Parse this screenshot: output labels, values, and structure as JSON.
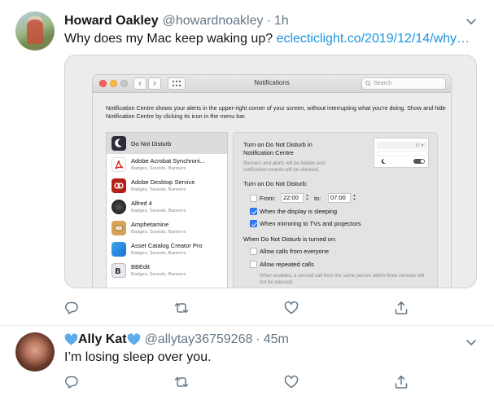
{
  "tweets": [
    {
      "name": "Howard Oakley",
      "handle": "@howardnoakley",
      "time": "1h",
      "text": "Why does my Mac keep waking up? ",
      "link": "eclecticlight.co/2019/12/14/why…",
      "media": {
        "window_title": "Notifications",
        "search_placeholder": "Search",
        "description": "Notification Centre shows your alerts in the upper-right corner of your screen, without interrupting what you're doing. Show and hide Notification Centre by clicking its icon in the menu bar.",
        "apps": [
          {
            "name": "Do Not Disturb",
            "sub": "",
            "selected": true
          },
          {
            "name": "Adobe Acrobat Synchroni...",
            "sub": "Badges, Sounds, Banners"
          },
          {
            "name": "Adobe Desktop Service",
            "sub": "Badges, Sounds, Banners"
          },
          {
            "name": "Alfred 4",
            "sub": "Badges, Sounds, Banners"
          },
          {
            "name": "Amphetamine",
            "sub": "Badges, Sounds, Banners"
          },
          {
            "name": "Asset Catalog Creator Pro",
            "sub": "Badges, Sounds, Banners"
          },
          {
            "name": "BBEdit",
            "sub": "Badges, Sounds, Banners"
          }
        ],
        "pane": {
          "turn_on_title": "Turn on Do Not Disturb in Notification Centre",
          "turn_on_desc": "Banners and alerts will be hidden and notification sounds will be silenced.",
          "section1": "Turn on Do Not Disturb:",
          "from_label": "From:",
          "from_value": "22:00",
          "to_label": "to:",
          "to_value": "07:00",
          "sleeping_label": "When the display is sleeping",
          "mirroring_label": "When mirroring to TVs and projectors",
          "section2": "When Do Not Disturb is turned on:",
          "calls_everyone_label": "Allow calls from everyone",
          "repeated_calls_label": "Allow repeated calls",
          "footnote": "When enabled, a second call from the same person within three minutes will not be silenced."
        }
      }
    },
    {
      "name": "Ally Kat",
      "handle": "@allytay36759268",
      "time": "45m",
      "text": "I’m losing sleep over you."
    }
  ],
  "icons": [
    "reply-icon",
    "retweet-icon",
    "like-icon",
    "share-icon",
    "chevron-down-icon",
    "heart-emoji-icon"
  ],
  "colors": {
    "link": "#1b95e0",
    "gray_text": "#657786",
    "heart_emoji": "#5dadec",
    "checkbox_on": "#2f7cf6"
  }
}
